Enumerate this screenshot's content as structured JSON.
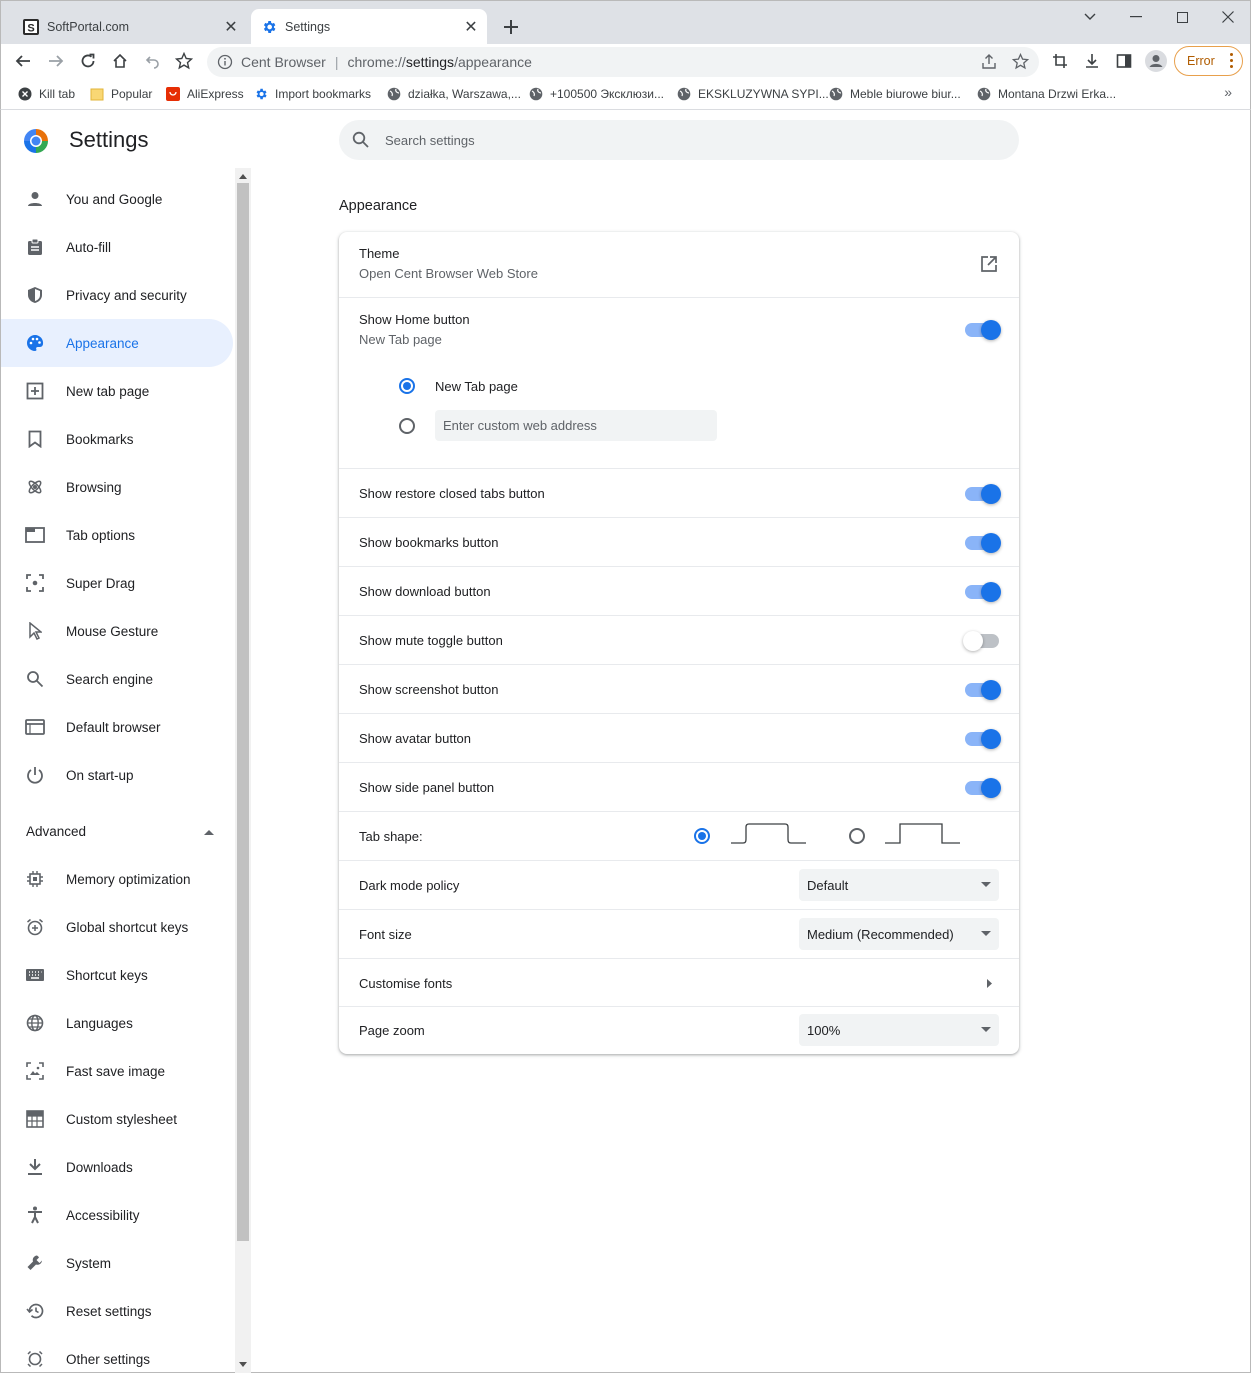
{
  "tabs": [
    {
      "title": "SoftPortal.com",
      "active": false
    },
    {
      "title": "Settings",
      "active": true
    }
  ],
  "toolbar": {
    "site_name": "Cent Browser",
    "url_prefix": "chrome://",
    "url_host": "settings",
    "url_path": "/appearance",
    "error_label": "Error"
  },
  "bookmarks": [
    {
      "label": "Kill tab",
      "icon": "kill-tab-icon"
    },
    {
      "label": "Popular",
      "icon": "folder-icon"
    },
    {
      "label": "AliExpress",
      "icon": "aliexpress-icon"
    },
    {
      "label": "Import bookmarks",
      "icon": "gear-icon"
    },
    {
      "label": "działka, Warszawa,...",
      "icon": "globe-icon"
    },
    {
      "label": "+100500 Эксклюзи...",
      "icon": "globe-icon"
    },
    {
      "label": "EKSKLUZYWNA SYPI...",
      "icon": "globe-icon"
    },
    {
      "label": "Meble biurowe biur...",
      "icon": "globe-icon"
    },
    {
      "label": "Montana Drzwi Erka...",
      "icon": "globe-icon"
    }
  ],
  "header": {
    "title": "Settings"
  },
  "search": {
    "placeholder": "Search settings"
  },
  "sidebar": {
    "items": [
      {
        "label": "You and Google",
        "icon": "person-icon"
      },
      {
        "label": "Auto-fill",
        "icon": "clipboard-icon"
      },
      {
        "label": "Privacy and security",
        "icon": "shield-icon"
      },
      {
        "label": "Appearance",
        "icon": "palette-icon",
        "selected": true
      },
      {
        "label": "New tab page",
        "icon": "new-tab-icon"
      },
      {
        "label": "Bookmarks",
        "icon": "bookmark-icon"
      },
      {
        "label": "Browsing",
        "icon": "browsing-icon"
      },
      {
        "label": "Tab options",
        "icon": "tab-icon"
      },
      {
        "label": "Super Drag",
        "icon": "drag-icon"
      },
      {
        "label": "Mouse Gesture",
        "icon": "cursor-icon"
      },
      {
        "label": "Search engine",
        "icon": "search-icon"
      },
      {
        "label": "Default browser",
        "icon": "browser-icon"
      },
      {
        "label": "On start-up",
        "icon": "power-icon"
      }
    ],
    "advanced_label": "Advanced",
    "advanced_items": [
      {
        "label": "Memory optimization",
        "icon": "chip-icon"
      },
      {
        "label": "Global shortcut keys",
        "icon": "alarm-add-icon"
      },
      {
        "label": "Shortcut keys",
        "icon": "keyboard-icon"
      },
      {
        "label": "Languages",
        "icon": "globe-icon"
      },
      {
        "label": "Fast save image",
        "icon": "image-save-icon"
      },
      {
        "label": "Custom stylesheet",
        "icon": "grid-icon"
      },
      {
        "label": "Downloads",
        "icon": "download-icon"
      },
      {
        "label": "Accessibility",
        "icon": "accessibility-icon"
      },
      {
        "label": "System",
        "icon": "wrench-icon"
      },
      {
        "label": "Reset settings",
        "icon": "history-icon"
      },
      {
        "label": "Other settings",
        "icon": "other-icon"
      }
    ]
  },
  "appearance": {
    "section_title": "Appearance",
    "theme": {
      "label": "Theme",
      "sublabel": "Open Cent Browser Web Store"
    },
    "home_button": {
      "label": "Show Home button",
      "sublabel": "New Tab page",
      "enabled": true,
      "option_new_tab": "New Tab page",
      "custom_placeholder": "Enter custom web address"
    },
    "toggles": [
      {
        "label": "Show restore closed tabs button",
        "enabled": true
      },
      {
        "label": "Show bookmarks button",
        "enabled": true
      },
      {
        "label": "Show download button",
        "enabled": true
      },
      {
        "label": "Show mute toggle button",
        "enabled": false
      },
      {
        "label": "Show screenshot button",
        "enabled": true
      },
      {
        "label": "Show avatar button",
        "enabled": true
      },
      {
        "label": "Show side panel button",
        "enabled": true
      }
    ],
    "tab_shape": {
      "label": "Tab shape:",
      "selected": "rounded"
    },
    "dark_mode": {
      "label": "Dark mode policy",
      "value": "Default"
    },
    "font_size": {
      "label": "Font size",
      "value": "Medium (Recommended)"
    },
    "customise_fonts": {
      "label": "Customise fonts"
    },
    "page_zoom": {
      "label": "Page zoom",
      "value": "100%"
    }
  },
  "colors": {
    "accent": "#1a73e8",
    "selected_bg": "#e8f0fe",
    "error": "#e8a04c"
  }
}
